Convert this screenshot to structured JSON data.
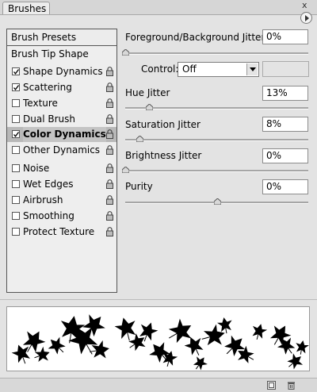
{
  "panel": {
    "tab_title": "Brushes",
    "close_glyph": "x"
  },
  "left_list": {
    "header": "Brush Presets",
    "items": [
      {
        "label": "Brush Tip Shape",
        "has_checkbox": false,
        "checked": false,
        "lock": false,
        "selected": false
      },
      {
        "label": "Shape Dynamics",
        "has_checkbox": true,
        "checked": true,
        "lock": true,
        "selected": false
      },
      {
        "label": "Scattering",
        "has_checkbox": true,
        "checked": true,
        "lock": true,
        "selected": false
      },
      {
        "label": "Texture",
        "has_checkbox": true,
        "checked": false,
        "lock": true,
        "selected": false
      },
      {
        "label": "Dual Brush",
        "has_checkbox": true,
        "checked": false,
        "lock": true,
        "selected": false
      },
      {
        "label": "Color Dynamics",
        "has_checkbox": true,
        "checked": true,
        "lock": true,
        "selected": true
      },
      {
        "label": "Other Dynamics",
        "has_checkbox": true,
        "checked": false,
        "lock": true,
        "selected": false
      },
      {
        "label": "Noise",
        "has_checkbox": true,
        "checked": false,
        "lock": true,
        "selected": false
      },
      {
        "label": "Wet Edges",
        "has_checkbox": true,
        "checked": false,
        "lock": true,
        "selected": false
      },
      {
        "label": "Airbrush",
        "has_checkbox": true,
        "checked": false,
        "lock": true,
        "selected": false
      },
      {
        "label": "Smoothing",
        "has_checkbox": true,
        "checked": false,
        "lock": true,
        "selected": false
      },
      {
        "label": "Protect Texture",
        "has_checkbox": true,
        "checked": false,
        "lock": true,
        "selected": false
      }
    ]
  },
  "settings": {
    "fg_bg_jitter": {
      "label": "Foreground/Background Jitter",
      "value": "0%",
      "level": 0
    },
    "control": {
      "label": "Control:",
      "value": "Off"
    },
    "hue_jitter": {
      "label": "Hue Jitter",
      "value": "13%",
      "level": 0.13
    },
    "saturation_jitter": {
      "label": "Saturation Jitter",
      "value": "8%",
      "level": 0.08
    },
    "brightness_jitter": {
      "label": "Brightness Jitter",
      "value": "0%",
      "level": 0
    },
    "purity": {
      "label": "Purity",
      "value": "0%",
      "level": 0.5
    }
  },
  "icons": {
    "panel_menu": "triangle-right-icon",
    "checkbox": "checkmark-icon",
    "lock": "lock-icon",
    "new_preset": "new-preset-icon",
    "delete": "trash-icon"
  },
  "colors": {
    "panel_bg": "#e3e3e3",
    "selected_row": "#b8b8b8",
    "brush_stroke": "#000000"
  }
}
